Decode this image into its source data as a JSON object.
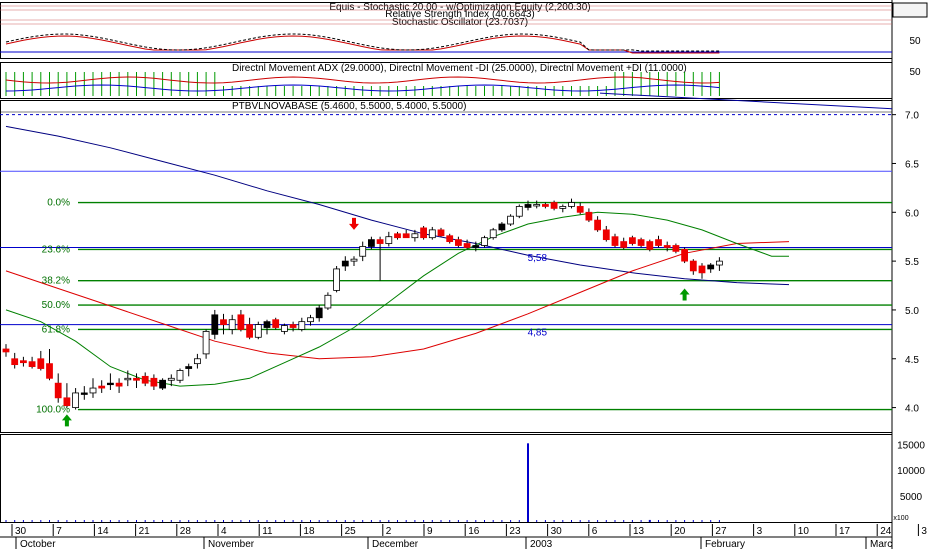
{
  "chart_data": {
    "type": "candlestick",
    "panels": {
      "stochastic": {
        "titles": [
          "Equis - Stochastic 20.00 - w/Optimization Equity (2,200.30)",
          "Relative Strength Index (40.6643)",
          "Stochastic Oscillator (23.7037)"
        ],
        "yticks": [
          "50"
        ],
        "level": 50
      },
      "dmi": {
        "title": "Directnl Movement ADX (29.0000), Directnl Movement -DI (25.0000), Directnl Movement +DI (11.0000)",
        "yticks": [
          "50"
        ]
      },
      "price": {
        "title": "PTBVLNOVABASE (5.4600, 5.5000, 5.4000, 5.5000)",
        "yticks": [
          "7.0",
          "6.5",
          "6.0",
          "5.5",
          "5.0",
          "4.5",
          "4.0"
        ],
        "ylim": [
          3.75,
          7.15
        ],
        "fib_levels": [
          {
            "label": "0.0%",
            "value": 6.1
          },
          {
            "label": "23.6%",
            "value": 5.62
          },
          {
            "label": "38.2%",
            "value": 5.3
          },
          {
            "label": "50.0%",
            "value": 5.05
          },
          {
            "label": "61.8%",
            "value": 4.8
          },
          {
            "label": "100.0%",
            "value": 3.98
          }
        ],
        "h_lines": [
          {
            "value": 6.42,
            "color": "#4a4aff"
          },
          {
            "value": 7.0,
            "color": "#0000cc",
            "dashed": true
          },
          {
            "value": 4.85,
            "color": "#0000cc"
          },
          {
            "value": 5.64,
            "color": "#0000cc"
          }
        ],
        "annotations": [
          {
            "text": "5,58",
            "date_index": 59,
            "value": 5.5
          },
          {
            "text": "4,85",
            "date_index": 59,
            "value": 4.74
          }
        ],
        "arrows": [
          {
            "type": "up",
            "date_index": 7,
            "color": "#009900"
          },
          {
            "type": "down",
            "date_index": 40,
            "color": "#ee0000"
          },
          {
            "type": "up",
            "date_index": 78,
            "color": "#009900"
          }
        ],
        "candles": [
          {
            "o": 4.6,
            "h": 4.65,
            "l": 4.52,
            "c": 4.57
          },
          {
            "o": 4.5,
            "h": 4.56,
            "l": 4.4,
            "c": 4.44
          },
          {
            "o": 4.48,
            "h": 4.52,
            "l": 4.42,
            "c": 4.46
          },
          {
            "o": 4.47,
            "h": 4.52,
            "l": 4.4,
            "c": 4.42
          },
          {
            "o": 4.5,
            "h": 4.58,
            "l": 4.38,
            "c": 4.4
          },
          {
            "o": 4.45,
            "h": 4.6,
            "l": 4.28,
            "c": 4.3
          },
          {
            "o": 4.25,
            "h": 4.35,
            "l": 4.05,
            "c": 4.1
          },
          {
            "o": 4.1,
            "h": 4.25,
            "l": 4.0,
            "c": 4.02
          },
          {
            "o": 4.0,
            "h": 4.2,
            "l": 3.98,
            "c": 4.15
          },
          {
            "o": 4.15,
            "h": 4.22,
            "l": 4.08,
            "c": 4.15
          },
          {
            "o": 4.15,
            "h": 4.3,
            "l": 4.1,
            "c": 4.2
          },
          {
            "o": 4.22,
            "h": 4.28,
            "l": 4.15,
            "c": 4.2
          },
          {
            "o": 4.25,
            "h": 4.35,
            "l": 4.18,
            "c": 4.25
          },
          {
            "o": 4.25,
            "h": 4.3,
            "l": 4.15,
            "c": 4.22
          },
          {
            "o": 4.3,
            "h": 4.38,
            "l": 4.22,
            "c": 4.3
          },
          {
            "o": 4.3,
            "h": 4.35,
            "l": 4.2,
            "c": 4.28
          },
          {
            "o": 4.32,
            "h": 4.36,
            "l": 4.22,
            "c": 4.25
          },
          {
            "o": 4.3,
            "h": 4.34,
            "l": 4.18,
            "c": 4.22
          },
          {
            "o": 4.2,
            "h": 4.3,
            "l": 4.18,
            "c": 4.28
          },
          {
            "o": 4.28,
            "h": 4.34,
            "l": 4.22,
            "c": 4.3
          },
          {
            "o": 4.28,
            "h": 4.4,
            "l": 4.25,
            "c": 4.38
          },
          {
            "o": 4.4,
            "h": 4.45,
            "l": 4.32,
            "c": 4.42
          },
          {
            "o": 4.45,
            "h": 4.55,
            "l": 4.4,
            "c": 4.5
          },
          {
            "o": 4.55,
            "h": 4.8,
            "l": 4.5,
            "c": 4.78
          },
          {
            "o": 4.75,
            "h": 5.0,
            "l": 4.7,
            "c": 4.95
          },
          {
            "o": 4.9,
            "h": 4.96,
            "l": 4.75,
            "c": 4.85
          },
          {
            "o": 4.8,
            "h": 4.95,
            "l": 4.75,
            "c": 4.9
          },
          {
            "o": 4.95,
            "h": 5.0,
            "l": 4.78,
            "c": 4.8
          },
          {
            "o": 4.85,
            "h": 4.92,
            "l": 4.7,
            "c": 4.72
          },
          {
            "o": 4.72,
            "h": 4.88,
            "l": 4.7,
            "c": 4.85
          },
          {
            "o": 4.82,
            "h": 4.9,
            "l": 4.75,
            "c": 4.88
          },
          {
            "o": 4.9,
            "h": 4.92,
            "l": 4.8,
            "c": 4.82
          },
          {
            "o": 4.78,
            "h": 4.86,
            "l": 4.75,
            "c": 4.84
          },
          {
            "o": 4.85,
            "h": 4.88,
            "l": 4.78,
            "c": 4.82
          },
          {
            "o": 4.8,
            "h": 4.92,
            "l": 4.78,
            "c": 4.88
          },
          {
            "o": 4.88,
            "h": 4.95,
            "l": 4.84,
            "c": 4.92
          },
          {
            "o": 4.92,
            "h": 5.05,
            "l": 4.88,
            "c": 5.02
          },
          {
            "o": 5.02,
            "h": 5.18,
            "l": 5.0,
            "c": 5.15
          },
          {
            "o": 5.2,
            "h": 5.45,
            "l": 5.18,
            "c": 5.42
          },
          {
            "o": 5.45,
            "h": 5.55,
            "l": 5.4,
            "c": 5.5
          },
          {
            "o": 5.5,
            "h": 5.55,
            "l": 5.45,
            "c": 5.52
          },
          {
            "o": 5.55,
            "h": 5.7,
            "l": 5.5,
            "c": 5.65
          },
          {
            "o": 5.65,
            "h": 5.75,
            "l": 5.62,
            "c": 5.72
          },
          {
            "o": 5.72,
            "h": 5.75,
            "l": 5.3,
            "c": 5.68
          },
          {
            "o": 5.68,
            "h": 5.8,
            "l": 5.65,
            "c": 5.75
          },
          {
            "o": 5.78,
            "h": 5.8,
            "l": 5.72,
            "c": 5.74
          },
          {
            "o": 5.78,
            "h": 5.82,
            "l": 5.74,
            "c": 5.74
          },
          {
            "o": 5.74,
            "h": 5.82,
            "l": 5.7,
            "c": 5.78
          },
          {
            "o": 5.84,
            "h": 5.86,
            "l": 5.72,
            "c": 5.74
          },
          {
            "o": 5.74,
            "h": 5.85,
            "l": 5.72,
            "c": 5.82
          },
          {
            "o": 5.82,
            "h": 5.84,
            "l": 5.75,
            "c": 5.76
          },
          {
            "o": 5.76,
            "h": 5.78,
            "l": 5.68,
            "c": 5.7
          },
          {
            "o": 5.72,
            "h": 5.75,
            "l": 5.64,
            "c": 5.66
          },
          {
            "o": 5.68,
            "h": 5.72,
            "l": 5.62,
            "c": 5.64
          },
          {
            "o": 5.64,
            "h": 5.7,
            "l": 5.6,
            "c": 5.66
          },
          {
            "o": 5.66,
            "h": 5.76,
            "l": 5.64,
            "c": 5.74
          },
          {
            "o": 5.74,
            "h": 5.84,
            "l": 5.72,
            "c": 5.82
          },
          {
            "o": 5.82,
            "h": 5.9,
            "l": 5.8,
            "c": 5.88
          },
          {
            "o": 5.88,
            "h": 5.98,
            "l": 5.86,
            "c": 5.96
          },
          {
            "o": 5.96,
            "h": 6.08,
            "l": 5.94,
            "c": 6.06
          },
          {
            "o": 6.05,
            "h": 6.12,
            "l": 6.02,
            "c": 6.08
          },
          {
            "o": 6.08,
            "h": 6.12,
            "l": 6.04,
            "c": 6.08
          },
          {
            "o": 6.08,
            "h": 6.1,
            "l": 6.04,
            "c": 6.06
          },
          {
            "o": 6.1,
            "h": 6.12,
            "l": 6.02,
            "c": 6.04
          },
          {
            "o": 6.04,
            "h": 6.08,
            "l": 6.0,
            "c": 6.06
          },
          {
            "o": 6.06,
            "h": 6.14,
            "l": 6.04,
            "c": 6.1
          },
          {
            "o": 6.06,
            "h": 6.1,
            "l": 5.98,
            "c": 6.0
          },
          {
            "o": 6.0,
            "h": 6.04,
            "l": 5.9,
            "c": 5.92
          },
          {
            "o": 5.92,
            "h": 5.96,
            "l": 5.8,
            "c": 5.82
          },
          {
            "o": 5.82,
            "h": 5.86,
            "l": 5.7,
            "c": 5.72
          },
          {
            "o": 5.75,
            "h": 5.78,
            "l": 5.64,
            "c": 5.66
          },
          {
            "o": 5.7,
            "h": 5.74,
            "l": 5.62,
            "c": 5.64
          },
          {
            "o": 5.74,
            "h": 5.76,
            "l": 5.66,
            "c": 5.68
          },
          {
            "o": 5.72,
            "h": 5.74,
            "l": 5.64,
            "c": 5.66
          },
          {
            "o": 5.7,
            "h": 5.72,
            "l": 5.6,
            "c": 5.62
          },
          {
            "o": 5.72,
            "h": 5.76,
            "l": 5.64,
            "c": 5.66
          },
          {
            "o": 5.66,
            "h": 5.7,
            "l": 5.6,
            "c": 5.64
          },
          {
            "o": 5.66,
            "h": 5.68,
            "l": 5.58,
            "c": 5.6
          },
          {
            "o": 5.62,
            "h": 5.64,
            "l": 5.48,
            "c": 5.5
          },
          {
            "o": 5.5,
            "h": 5.52,
            "l": 5.36,
            "c": 5.4
          },
          {
            "o": 5.45,
            "h": 5.48,
            "l": 5.32,
            "c": 5.38
          },
          {
            "o": 5.42,
            "h": 5.48,
            "l": 5.38,
            "c": 5.46
          },
          {
            "o": 5.46,
            "h": 5.54,
            "l": 5.4,
            "c": 5.5
          }
        ],
        "overlays": [
          {
            "color": "#000080",
            "points": [
              [
                0,
                6.88
              ],
              [
                6,
                6.78
              ],
              [
                12,
                6.66
              ],
              [
                18,
                6.52
              ],
              [
                24,
                6.38
              ],
              [
                30,
                6.22
              ],
              [
                36,
                6.08
              ],
              [
                42,
                5.92
              ],
              [
                48,
                5.78
              ],
              [
                54,
                5.68
              ],
              [
                60,
                5.56
              ],
              [
                66,
                5.46
              ],
              [
                72,
                5.38
              ],
              [
                78,
                5.32
              ],
              [
                84,
                5.28
              ],
              [
                90,
                5.26
              ]
            ]
          },
          {
            "color": "#dd0000",
            "points": [
              [
                0,
                5.4
              ],
              [
                6,
                5.22
              ],
              [
                12,
                5.04
              ],
              [
                18,
                4.86
              ],
              [
                24,
                4.68
              ],
              [
                30,
                4.56
              ],
              [
                36,
                4.5
              ],
              [
                42,
                4.52
              ],
              [
                48,
                4.6
              ],
              [
                54,
                4.76
              ],
              [
                60,
                4.96
              ],
              [
                66,
                5.18
              ],
              [
                72,
                5.4
              ],
              [
                78,
                5.58
              ],
              [
                84,
                5.68
              ],
              [
                90,
                5.7
              ]
            ]
          },
          {
            "color": "#008000",
            "points": [
              [
                0,
                5.0
              ],
              [
                4,
                4.88
              ],
              [
                8,
                4.68
              ],
              [
                12,
                4.42
              ],
              [
                16,
                4.28
              ],
              [
                20,
                4.22
              ],
              [
                24,
                4.24
              ],
              [
                28,
                4.3
              ],
              [
                32,
                4.46
              ],
              [
                36,
                4.62
              ],
              [
                40,
                4.82
              ],
              [
                44,
                5.08
              ],
              [
                48,
                5.35
              ],
              [
                52,
                5.58
              ],
              [
                56,
                5.75
              ],
              [
                60,
                5.88
              ],
              [
                64,
                5.95
              ],
              [
                68,
                6.0
              ],
              [
                72,
                5.98
              ],
              [
                76,
                5.92
              ],
              [
                80,
                5.82
              ],
              [
                84,
                5.68
              ],
              [
                88,
                5.55
              ],
              [
                90,
                5.55
              ]
            ]
          }
        ]
      },
      "volume": {
        "yticks": [
          "15000",
          "10000",
          "5000"
        ],
        "ylim": [
          0,
          17000
        ],
        "unit": "x100",
        "bars": [
          [
            60,
            15200
          ],
          [
            74,
            400
          ]
        ]
      }
    },
    "x_axis": {
      "day_ticks": [
        "30",
        "7",
        "14",
        "21",
        "28",
        "4",
        "11",
        "18",
        "25",
        "2",
        "9",
        "16",
        "23",
        "30",
        "6",
        "13",
        "20",
        "27",
        "3",
        "10",
        "17",
        "24",
        "3"
      ],
      "month_labels": [
        "October",
        "November",
        "December",
        "2003",
        "February",
        "Marc"
      ]
    }
  }
}
